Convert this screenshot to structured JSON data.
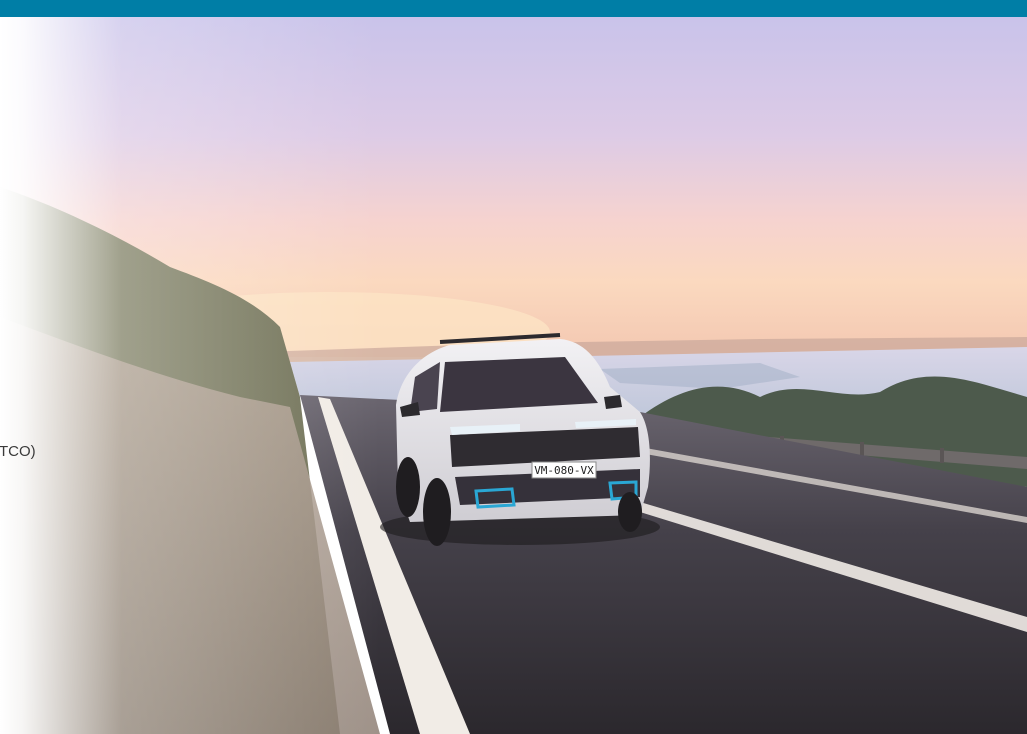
{
  "header": {
    "bar_color": "#007ea6"
  },
  "hero": {
    "plate_text": "VM-080-VX",
    "side_text": "(TCO)"
  }
}
